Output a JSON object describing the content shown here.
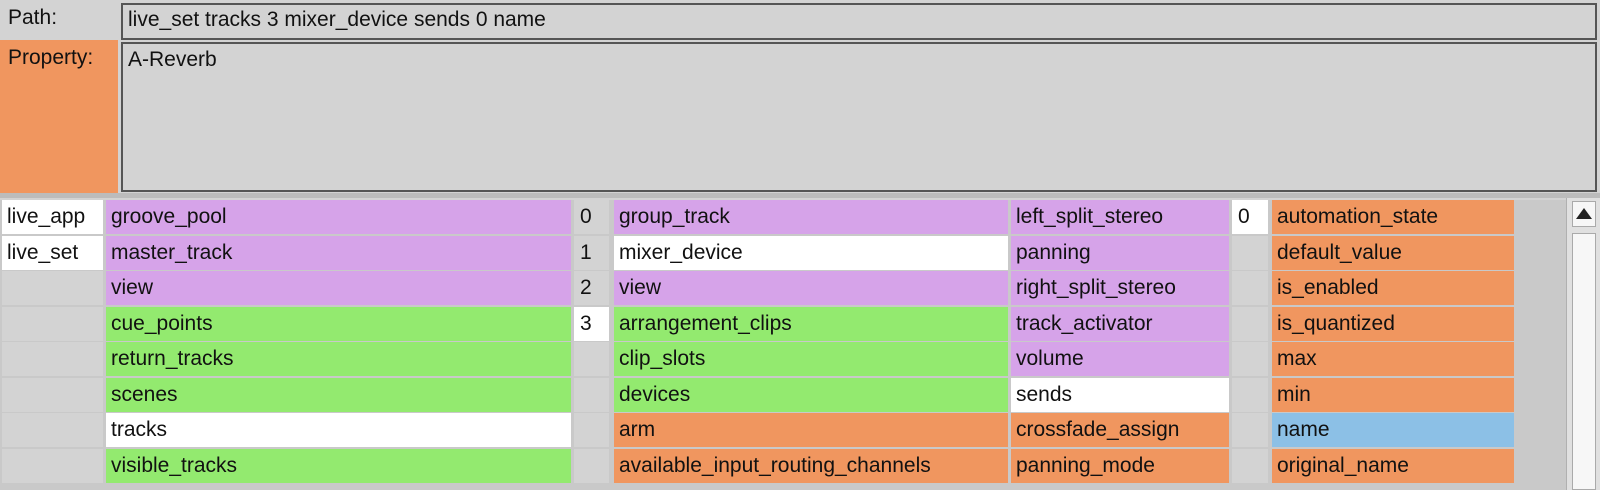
{
  "header": {
    "path_label": "Path:",
    "path_value": "live_set tracks 3 mixer_device sends 0 name",
    "property_label": "Property:",
    "property_value": "A-Reverb"
  },
  "browser": {
    "col1": [
      {
        "text": "live_app",
        "color": "white"
      },
      {
        "text": "live_set",
        "color": "white"
      },
      {
        "text": "",
        "color": "gray"
      },
      {
        "text": "",
        "color": "gray"
      },
      {
        "text": "",
        "color": "gray"
      },
      {
        "text": "",
        "color": "gray"
      },
      {
        "text": "",
        "color": "gray"
      },
      {
        "text": "",
        "color": "gray"
      }
    ],
    "col2": [
      {
        "text": "groove_pool",
        "color": "purple"
      },
      {
        "text": "master_track",
        "color": "purple"
      },
      {
        "text": "view",
        "color": "purple"
      },
      {
        "text": "cue_points",
        "color": "green"
      },
      {
        "text": "return_tracks",
        "color": "green"
      },
      {
        "text": "scenes",
        "color": "green"
      },
      {
        "text": "tracks",
        "color": "white"
      },
      {
        "text": "visible_tracks",
        "color": "green"
      }
    ],
    "col3": [
      {
        "text": "0",
        "color": "gray"
      },
      {
        "text": "1",
        "color": "gray"
      },
      {
        "text": "2",
        "color": "gray"
      },
      {
        "text": "3",
        "color": "white"
      },
      {
        "text": "",
        "color": "gray"
      },
      {
        "text": "",
        "color": "gray"
      },
      {
        "text": "",
        "color": "gray"
      },
      {
        "text": "",
        "color": "gray"
      }
    ],
    "col4": [
      {
        "text": "group_track",
        "color": "purple"
      },
      {
        "text": "mixer_device",
        "color": "white"
      },
      {
        "text": "view",
        "color": "purple"
      },
      {
        "text": "arrangement_clips",
        "color": "green"
      },
      {
        "text": "clip_slots",
        "color": "green"
      },
      {
        "text": "devices",
        "color": "green"
      },
      {
        "text": "arm",
        "color": "orange"
      },
      {
        "text": "available_input_routing_channels",
        "color": "orange"
      }
    ],
    "col5": [
      {
        "text": "left_split_stereo",
        "color": "purple"
      },
      {
        "text": "panning",
        "color": "purple"
      },
      {
        "text": "right_split_stereo",
        "color": "purple"
      },
      {
        "text": "track_activator",
        "color": "purple"
      },
      {
        "text": "volume",
        "color": "purple"
      },
      {
        "text": "sends",
        "color": "white"
      },
      {
        "text": "crossfade_assign",
        "color": "orange"
      },
      {
        "text": "panning_mode",
        "color": "orange"
      }
    ],
    "col6": [
      {
        "text": "0",
        "color": "white"
      },
      {
        "text": "",
        "color": "gray"
      },
      {
        "text": "",
        "color": "gray"
      },
      {
        "text": "",
        "color": "gray"
      },
      {
        "text": "",
        "color": "gray"
      },
      {
        "text": "",
        "color": "gray"
      },
      {
        "text": "",
        "color": "gray"
      },
      {
        "text": "",
        "color": "gray"
      }
    ],
    "col7": [
      {
        "text": "automation_state",
        "color": "orange"
      },
      {
        "text": "default_value",
        "color": "orange"
      },
      {
        "text": "is_enabled",
        "color": "orange"
      },
      {
        "text": "is_quantized",
        "color": "orange"
      },
      {
        "text": "max",
        "color": "orange"
      },
      {
        "text": "min",
        "color": "orange"
      },
      {
        "text": "name",
        "color": "blue"
      },
      {
        "text": "original_name",
        "color": "orange"
      }
    ]
  },
  "colors": {
    "purple": "#d6a3e9",
    "green": "#93ea6f",
    "orange": "#f0965f",
    "blue": "#8cc0e6",
    "white": "#ffffff",
    "gray": "#d3d3d3"
  },
  "scrollbar": {
    "up_icon": "scroll-up-arrow-icon"
  }
}
